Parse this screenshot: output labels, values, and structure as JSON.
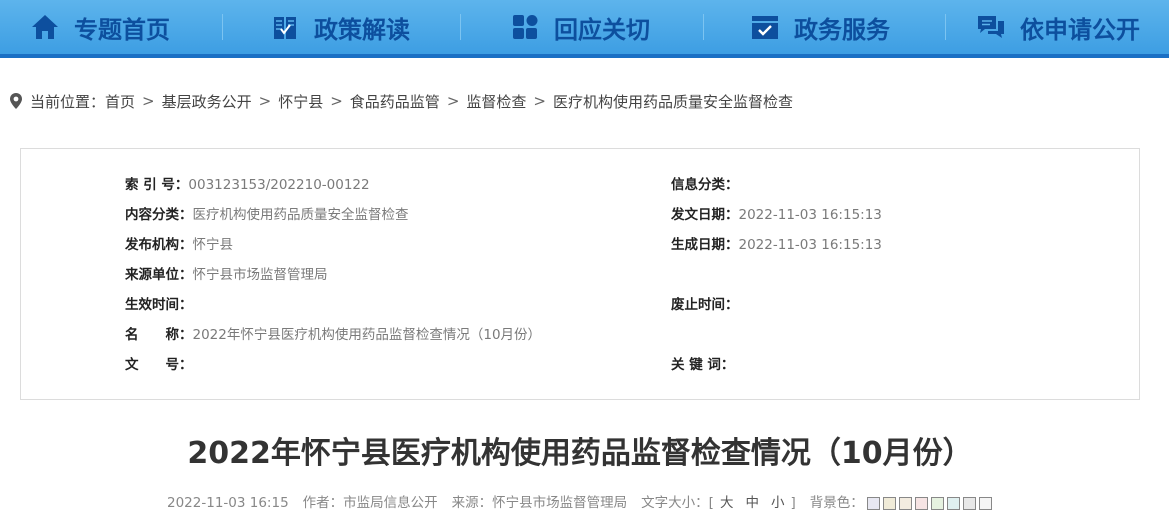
{
  "nav": {
    "items": [
      {
        "label": "专题首页",
        "icon": "home-icon"
      },
      {
        "label": "政策解读",
        "icon": "book-icon"
      },
      {
        "label": "回应关切",
        "icon": "grid-icon"
      },
      {
        "label": "政务服务",
        "icon": "checkbox-icon"
      },
      {
        "label": "依申请公开",
        "icon": "chat-icon"
      }
    ],
    "text_color": "#0d4f9e",
    "bg_color": "#4aa8e8"
  },
  "breadcrumb": {
    "prefix": "当前位置：",
    "items": [
      "首页",
      "基层政务公开",
      "怀宁县",
      "食品药品监管",
      "监督检查",
      "医疗机构使用药品质量安全监督检查"
    ],
    "separator": ">"
  },
  "meta": {
    "index_no": {
      "label": "索 引 号：",
      "value": "003123153/202210-00122"
    },
    "info_category": {
      "label": "信息分类：",
      "value": ""
    },
    "content_category": {
      "label": "内容分类：",
      "value": "医疗机构使用药品质量安全监督检查"
    },
    "issue_date": {
      "label": "发文日期：",
      "value": "2022-11-03 16:15:13"
    },
    "publisher": {
      "label": "发布机构：",
      "value": "怀宁县"
    },
    "generated_date": {
      "label": "生成日期：",
      "value": "2022-11-03 16:15:13"
    },
    "source_unit": {
      "label": "来源单位：",
      "value": "怀宁县市场监督管理局"
    },
    "effective_time": {
      "label": "生效时间：",
      "value": ""
    },
    "repeal_time": {
      "label": "废止时间：",
      "value": ""
    },
    "name": {
      "label": "名　　称：",
      "value": "2022年怀宁县医疗机构使用药品监督检查情况（10月份）"
    },
    "doc_no": {
      "label": "文　　号：",
      "value": ""
    },
    "keywords": {
      "label": "关 键 词：",
      "value": ""
    }
  },
  "article": {
    "title": "2022年怀宁县医疗机构使用药品监督检查情况（10月份）",
    "datetime": "2022-11-03 16:15",
    "author": "作者：市监局信息公开",
    "source": "来源：怀宁县市场监督管理局",
    "font_size_label": "文字大小：[",
    "font_size_close": "]",
    "font_sizes": [
      "大",
      "中",
      "小"
    ],
    "bg_color_label": "背景色：",
    "bg_swatches": [
      "#e8e8f2",
      "#f0ebd8",
      "#f3ece0",
      "#f6e4e4",
      "#e6f2e0",
      "#e0f0f0",
      "#e8e8e8",
      "#f5f5f5"
    ]
  }
}
